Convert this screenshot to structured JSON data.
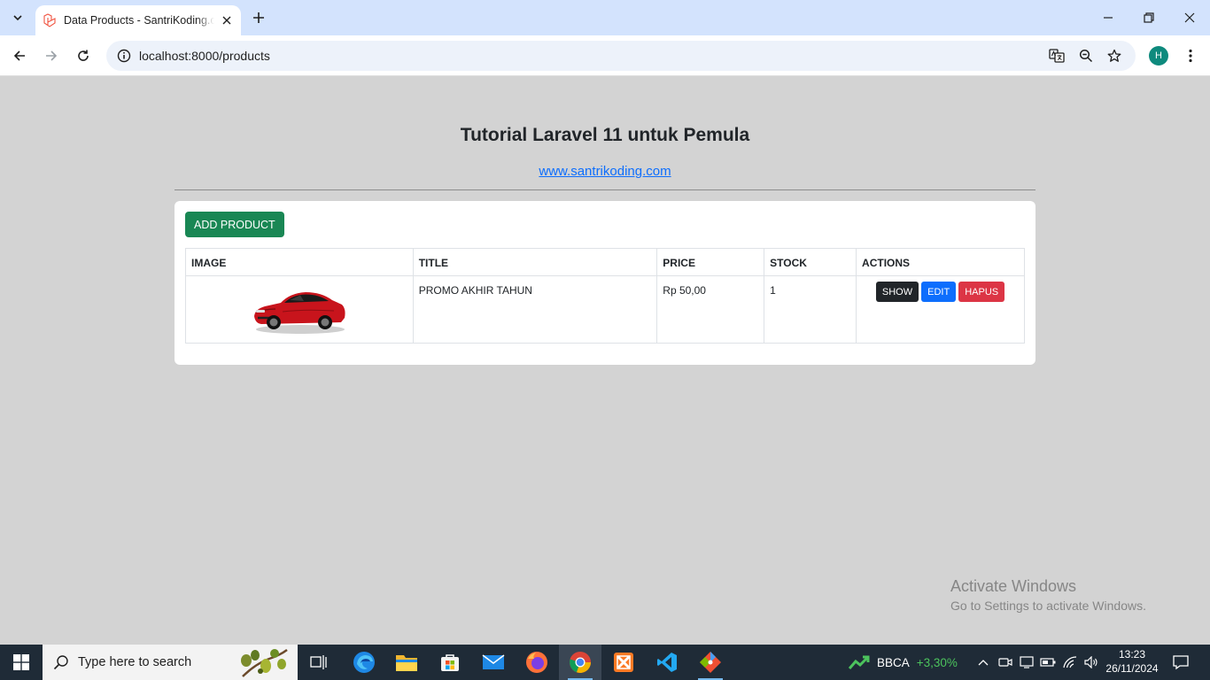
{
  "browser": {
    "tab_title": "Data Products - SantriKoding.com",
    "url": "localhost:8000/products",
    "profile_initial": "H"
  },
  "page": {
    "heading": "Tutorial Laravel 11 untuk Pemula",
    "link_text": "www.santrikoding.com",
    "add_button": "ADD PRODUCT",
    "table": {
      "headers": [
        "IMAGE",
        "TITLE",
        "PRICE",
        "STOCK",
        "ACTIONS"
      ],
      "rows": [
        {
          "image": "red-car-image",
          "title": "PROMO AKHIR TAHUN",
          "price": "Rp 50,00",
          "stock": "1",
          "actions": {
            "show": "SHOW",
            "edit": "EDIT",
            "delete": "HAPUS"
          }
        }
      ]
    }
  },
  "watermark": {
    "line1": "Activate Windows",
    "line2": "Go to Settings to activate Windows."
  },
  "taskbar": {
    "search_placeholder": "Type here to search",
    "stock_ticker": "BBCA",
    "stock_change": "+3,30%",
    "time": "13:23",
    "date": "26/11/2024"
  },
  "colors": {
    "page_bg": "#d3d3d3",
    "success": "#198754",
    "dark": "#212529",
    "primary": "#0d6efd",
    "danger": "#dc3545"
  }
}
